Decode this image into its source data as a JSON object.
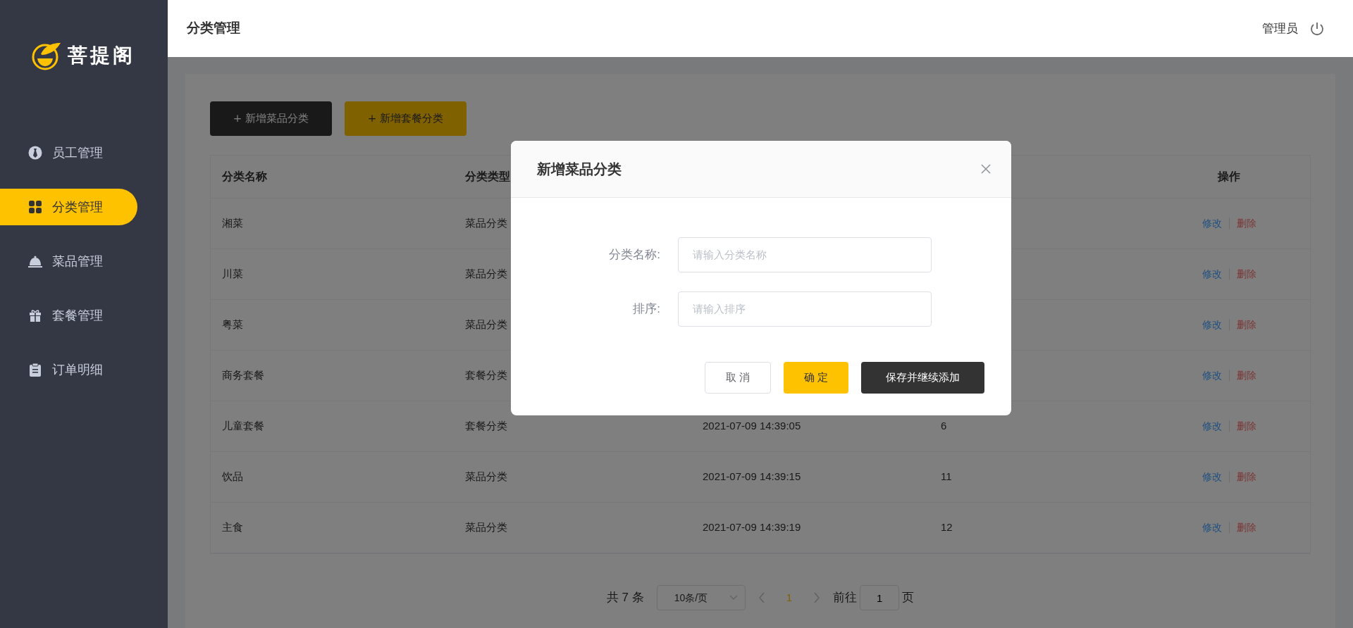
{
  "logo": {
    "text": "菩提阁"
  },
  "sidebar": {
    "items": [
      {
        "label": "员工管理",
        "selected": false
      },
      {
        "label": "分类管理",
        "selected": true
      },
      {
        "label": "菜品管理",
        "selected": false
      },
      {
        "label": "套餐管理",
        "selected": false
      },
      {
        "label": "订单明细",
        "selected": false
      }
    ]
  },
  "header": {
    "title": "分类管理",
    "user": "管理员"
  },
  "toolbar": {
    "buttons": [
      {
        "label": "+ 新增菜品分类",
        "kind": "dark"
      },
      {
        "label": "+ 新增套餐分类",
        "kind": "yellow"
      }
    ]
  },
  "table": {
    "columns": [
      "分类名称",
      "分类类型",
      "操作"
    ],
    "rows": [
      {
        "name": "湘菜",
        "type": "菜品分类",
        "actions": [
          {
            "label": "修改",
            "kind": "edit"
          },
          {
            "label": "删除",
            "kind": "delete"
          }
        ]
      },
      {
        "name": "川菜",
        "type": "菜品分类",
        "actions": [
          {
            "label": "修改",
            "kind": "edit"
          },
          {
            "label": "删除",
            "kind": "delete"
          }
        ]
      },
      {
        "name": "粤菜",
        "type": "菜品分类",
        "actions": [
          {
            "label": "修改",
            "kind": "edit"
          },
          {
            "label": "删除",
            "kind": "delete"
          }
        ]
      },
      {
        "name": "商务套餐",
        "type": "套餐分类",
        "actions": [
          {
            "label": "修改",
            "kind": "edit"
          },
          {
            "label": "删除",
            "kind": "delete"
          }
        ]
      },
      {
        "name": "儿童套餐",
        "type": "套餐分类",
        "time": "2021-07-09 14:39:05",
        "sort": "6",
        "actions": [
          {
            "label": "修改",
            "kind": "edit"
          },
          {
            "label": "删除",
            "kind": "delete"
          }
        ]
      },
      {
        "name": "饮品",
        "type": "菜品分类",
        "time": "2021-07-09 14:39:15",
        "sort": "11",
        "actions": [
          {
            "label": "修改",
            "kind": "edit"
          },
          {
            "label": "删除",
            "kind": "delete"
          }
        ]
      },
      {
        "name": "主食",
        "type": "菜品分类",
        "time": "2021-07-09 14:39:19",
        "sort": "12",
        "actions": [
          {
            "label": "修改",
            "kind": "edit"
          },
          {
            "label": "删除",
            "kind": "delete"
          }
        ]
      }
    ]
  },
  "pagination": {
    "total": "共 7 条",
    "page_size": "10条/页",
    "pages": [
      {
        "label": "1",
        "selected": true
      }
    ],
    "goto_label": "前往",
    "goto_value": "1",
    "goto_suffix": "页"
  },
  "dialog": {
    "title": "新增菜品分类",
    "fields": [
      {
        "label": "分类名称:",
        "placeholder": "请输入分类名称"
      },
      {
        "label": "排序:",
        "placeholder": "请输入排序"
      }
    ],
    "buttons": [
      {
        "label": "取 消",
        "kind": "plain"
      },
      {
        "label": "确 定",
        "kind": "primary"
      },
      {
        "label": "保存并继续添加",
        "kind": "dark"
      }
    ]
  }
}
